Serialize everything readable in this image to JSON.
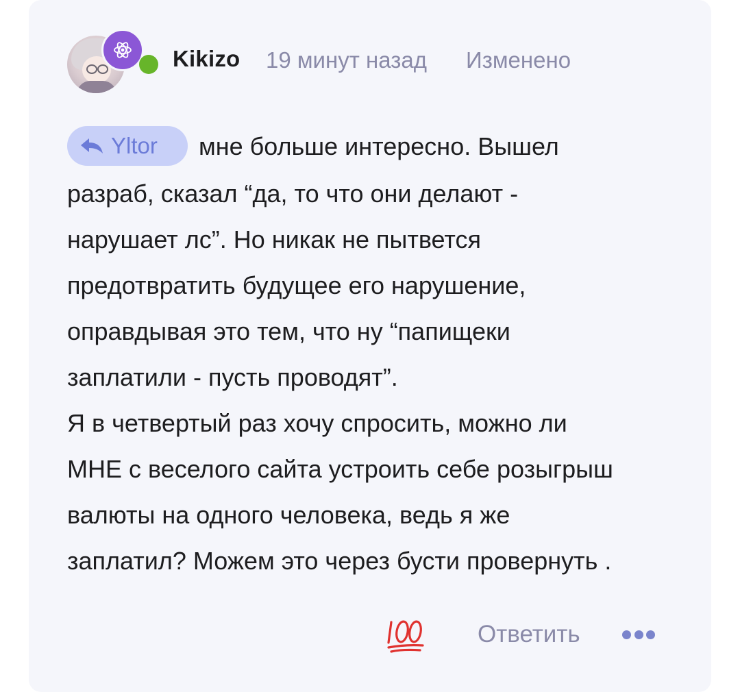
{
  "comment": {
    "username": "Kikizo",
    "timestamp": "19 минут назад",
    "edited_label": "Изменено",
    "reply_to": "Yltor",
    "lines": [
      "мне больше интересно. Вышел",
      "разраб, сказал “да, то что они делают -",
      "нарушает лс”. Но никак не пытвется",
      "предотвратить будущее его нарушение,",
      "оправдывая это тем, что ну “папищеки",
      "заплатили - пусть проводят”.",
      "Я в четвертый раз хочу спросить, можно ли",
      "МНЕ с веселого сайта устроить себе розыгрыш",
      "валюты на одного человека, ведь я же",
      "заплатил? Можем это через бусти провернуть ."
    ]
  },
  "footer": {
    "reaction_icon": "hundred-points-icon",
    "reply_label": "Ответить",
    "more_icon": "ellipsis-icon"
  },
  "colors": {
    "card_bg": "#f5f6fb",
    "online": "#67b52a",
    "react_badge": "#8b57d6",
    "chip_bg": "#c8d0f8",
    "chip_text": "#6b7bd8",
    "muted": "#8a8aa8",
    "hundred": "#e0322f"
  }
}
